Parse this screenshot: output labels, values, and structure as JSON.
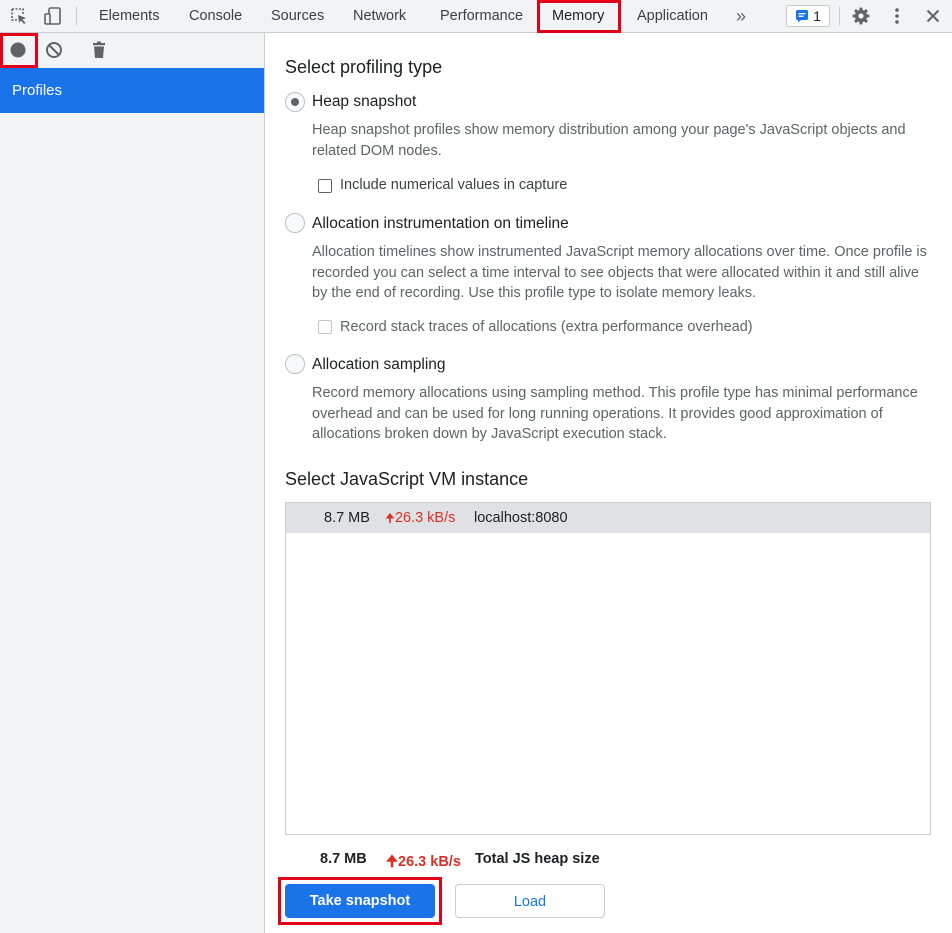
{
  "topbar": {
    "icons": [
      "inspect-element-icon",
      "device-toolbar-icon"
    ],
    "tabs": [
      {
        "label": "Elements"
      },
      {
        "label": "Console"
      },
      {
        "label": "Sources"
      },
      {
        "label": "Network"
      },
      {
        "label": "Performance"
      },
      {
        "label": "Memory",
        "active": true
      },
      {
        "label": "Application"
      }
    ],
    "more_tabs_glyph": "»",
    "issues_count": "1",
    "right_icons": [
      "settings-gear-icon",
      "kebab-menu-icon",
      "close-icon"
    ]
  },
  "sidebar": {
    "toolbar_icons": [
      "record-icon",
      "clear-all-icon",
      "collect-garbage-icon"
    ],
    "items": [
      {
        "label": "Profiles",
        "selected": true
      }
    ]
  },
  "main": {
    "profiling_title": "Select profiling type",
    "options": [
      {
        "label": "Heap snapshot",
        "checked": true,
        "description": "Heap snapshot profiles show memory distribution among your page's JavaScript objects and related DOM nodes.",
        "checkbox": {
          "label": "Include numerical values in capture",
          "checked": false,
          "disabled": false
        }
      },
      {
        "label": "Allocation instrumentation on timeline",
        "checked": false,
        "description": "Allocation timelines show instrumented JavaScript memory allocations over time. Once profile is recorded you can select a time interval to see objects that were allocated within it and still alive by the end of recording. Use this profile type to isolate memory leaks.",
        "checkbox": {
          "label": "Record stack traces of allocations (extra performance overhead)",
          "checked": false,
          "disabled": true
        }
      },
      {
        "label": "Allocation sampling",
        "checked": false,
        "description": "Record memory allocations using sampling method. This profile type has minimal performance overhead and can be used for long running operations. It provides good approximation of allocations broken down by JavaScript execution stack."
      }
    ],
    "vm_title": "Select JavaScript VM instance",
    "vm_instances": [
      {
        "size": "8.7 MB",
        "rate": "26.3 kB/s",
        "url": "localhost:8080"
      }
    ],
    "summary": {
      "size": "8.7 MB",
      "rate": "26.3 kB/s",
      "label": "Total JS heap size"
    },
    "buttons": {
      "take_snapshot": "Take snapshot",
      "load": "Load"
    }
  },
  "colors": {
    "accent": "#1a73e8",
    "highlight": "#e3001b",
    "rate": "#d93025"
  }
}
